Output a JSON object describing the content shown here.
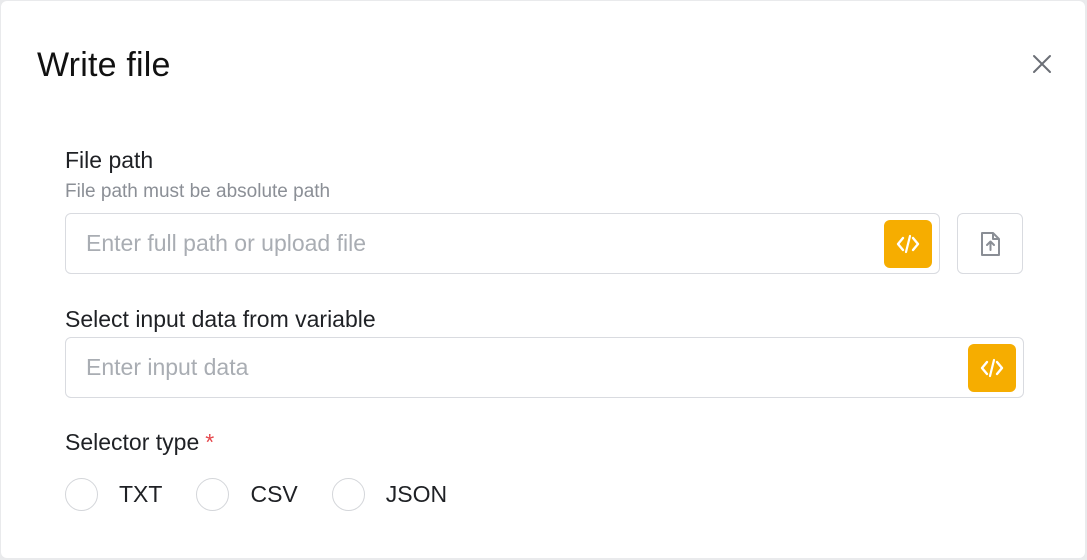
{
  "dialog": {
    "title": "Write file",
    "close_icon": "close-icon"
  },
  "file_path": {
    "label": "File path",
    "help": "File path must be absolute path",
    "placeholder": "Enter full path or upload file",
    "value": "",
    "code_icon": "code-icon",
    "upload_icon": "file-upload-icon"
  },
  "input_data": {
    "label": "Select input data from variable",
    "placeholder": "Enter input data",
    "value": "",
    "code_icon": "code-icon"
  },
  "selector_type": {
    "label": "Selector type",
    "required_mark": "*",
    "options": [
      {
        "label": "TXT",
        "selected": false
      },
      {
        "label": "CSV",
        "selected": false
      },
      {
        "label": "JSON",
        "selected": false
      }
    ]
  },
  "colors": {
    "accent": "#f6ad00",
    "required": "#e5484d",
    "border": "#d9dbe0",
    "placeholder": "#a9adb3"
  }
}
